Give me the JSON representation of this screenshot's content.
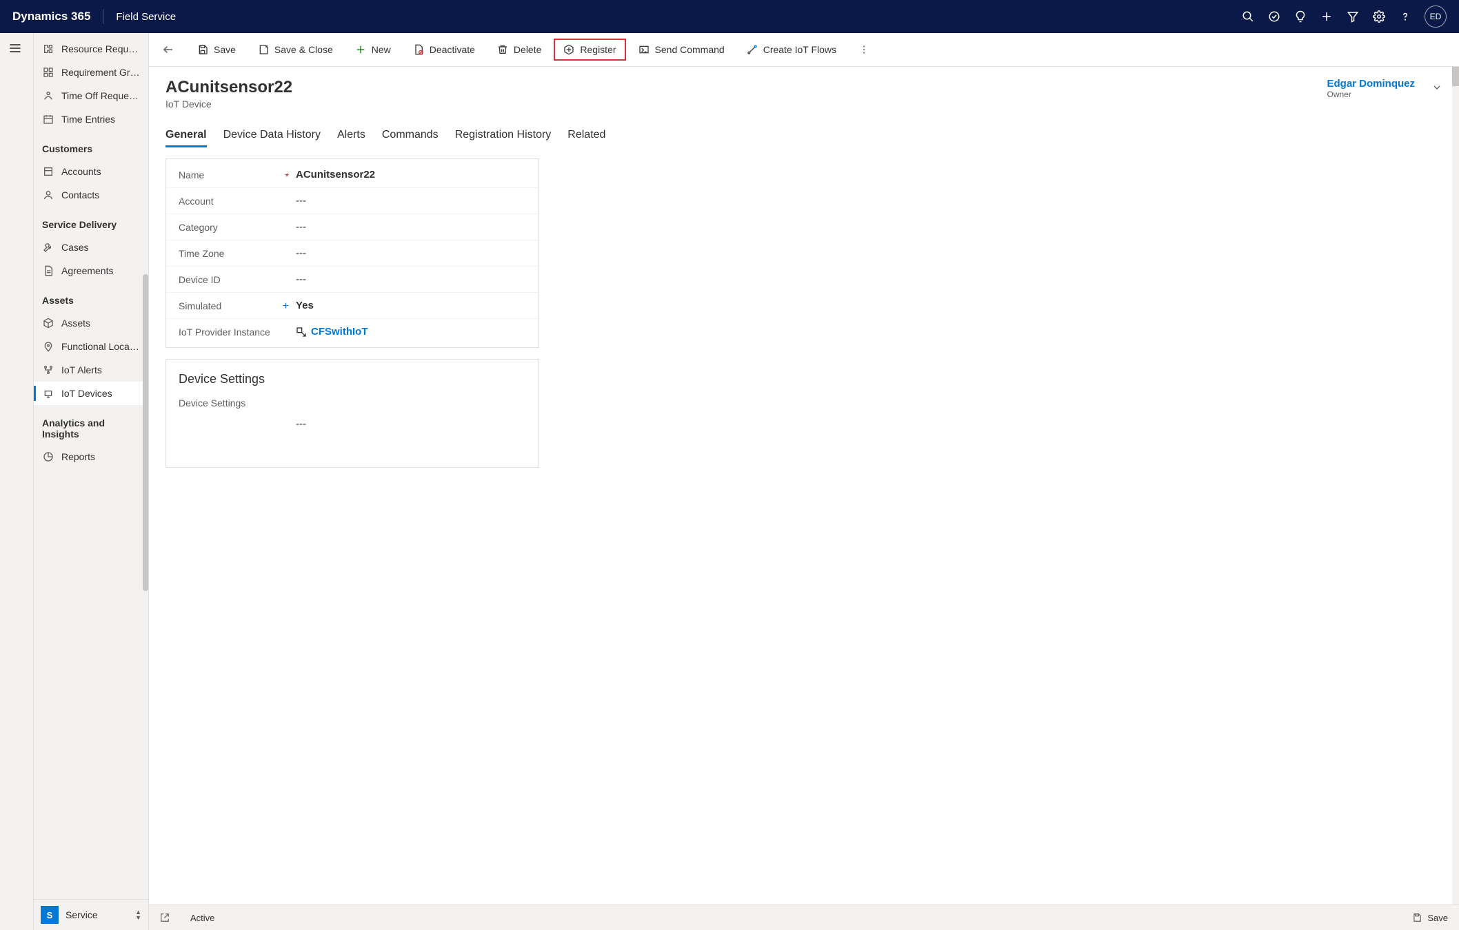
{
  "header": {
    "brand": "Dynamics 365",
    "module": "Field Service",
    "avatar_initials": "ED"
  },
  "sidebar": {
    "top_items": [
      {
        "label": "Resource Require…"
      },
      {
        "label": "Requirement Grou…"
      },
      {
        "label": "Time Off Requests"
      },
      {
        "label": "Time Entries"
      }
    ],
    "customers_header": "Customers",
    "customers_items": [
      {
        "label": "Accounts"
      },
      {
        "label": "Contacts"
      }
    ],
    "service_header": "Service Delivery",
    "service_items": [
      {
        "label": "Cases"
      },
      {
        "label": "Agreements"
      }
    ],
    "assets_header": "Assets",
    "assets_items": [
      {
        "label": "Assets"
      },
      {
        "label": "Functional Locations"
      },
      {
        "label": "IoT Alerts"
      },
      {
        "label": "IoT Devices"
      }
    ],
    "analytics_header": "Analytics and Insights",
    "analytics_items": [
      {
        "label": "Reports"
      }
    ],
    "area_badge": "S",
    "area_label": "Service"
  },
  "commands": {
    "save": "Save",
    "save_close": "Save & Close",
    "new": "New",
    "deactivate": "Deactivate",
    "delete": "Delete",
    "register": "Register",
    "send_command": "Send Command",
    "create_flows": "Create IoT Flows"
  },
  "record": {
    "title": "ACunitsensor22",
    "entity": "IoT Device",
    "owner_name": "Edgar Dominquez",
    "owner_role": "Owner"
  },
  "tabs": [
    "General",
    "Device Data History",
    "Alerts",
    "Commands",
    "Registration History",
    "Related"
  ],
  "form": {
    "name_label": "Name",
    "name_value": "ACunitsensor22",
    "account_label": "Account",
    "account_value": "---",
    "category_label": "Category",
    "category_value": "---",
    "timezone_label": "Time Zone",
    "timezone_value": "---",
    "deviceid_label": "Device ID",
    "deviceid_value": "---",
    "simulated_label": "Simulated",
    "simulated_value": "Yes",
    "provider_label": "IoT Provider Instance",
    "provider_value": "CFSwithIoT"
  },
  "settings": {
    "panel_title": "Device Settings",
    "field_label": "Device Settings",
    "field_value": "---"
  },
  "status_bar": {
    "status": "Active",
    "save": "Save"
  }
}
